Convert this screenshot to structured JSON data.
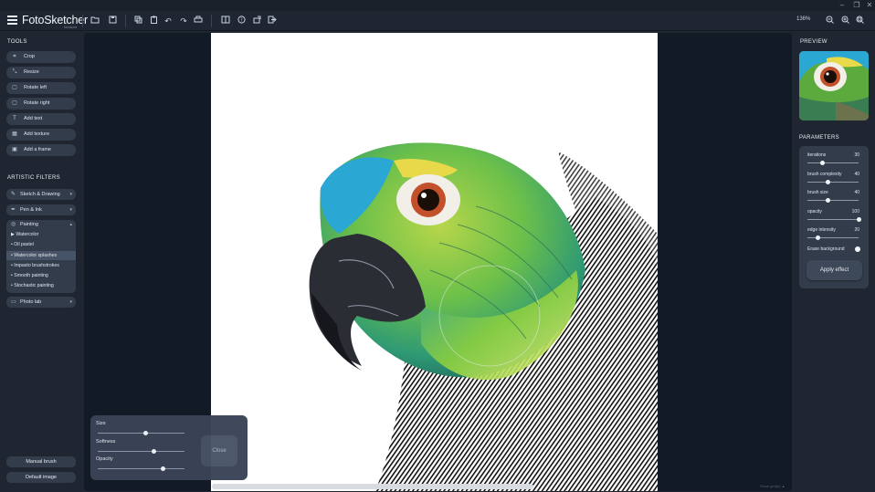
{
  "app": {
    "title": "FotoSketcher",
    "subtitle": "foto&art",
    "window_controls": [
      "–",
      "❐",
      "✕"
    ]
  },
  "toolbar": {
    "zoom": "136%",
    "icons": [
      "open-folder-icon",
      "save-icon",
      "copy-icon",
      "paste-icon",
      "undo-icon",
      "redo-icon",
      "print-icon",
      "compare-icon",
      "help-icon",
      "share-icon",
      "exit-icon",
      "zoom-out-icon",
      "zoom-in-icon",
      "zoom-fit-icon"
    ]
  },
  "tools": {
    "title": "TOOLS",
    "items": [
      {
        "label": "Crop",
        "icon": "crop-icon"
      },
      {
        "label": "Resize",
        "icon": "resize-icon"
      },
      {
        "label": "Rotate left",
        "icon": "rotate-left-icon"
      },
      {
        "label": "Rotate right",
        "icon": "rotate-right-icon"
      },
      {
        "label": "Add text",
        "icon": "text-icon"
      },
      {
        "label": "Add texture",
        "icon": "texture-icon"
      },
      {
        "label": "Add a frame",
        "icon": "frame-icon"
      }
    ]
  },
  "filters": {
    "title": "ARTISTIC FILTERS",
    "sketch": "Sketch & Drawing",
    "pen": "Pen & Ink",
    "painting": "Painting",
    "painting_items": [
      "▶ Watercolor",
      "• Oil pastel",
      "• Watercolor splashes",
      "• Impasto brushstrokes",
      "• Smooth painting",
      "• Stochastic painting"
    ],
    "selected_index": 2,
    "photo_lab": "Photo lab"
  },
  "bottom_buttons": {
    "manual_brush": "Manual brush",
    "default_image": "Default image"
  },
  "brush_popup": {
    "size_label": "Size",
    "softness_label": "Softness",
    "opacity_label": "Opacity",
    "size_value": 0.55,
    "softness_value": 0.65,
    "opacity_value": 0.75,
    "close_label": "Close"
  },
  "preview": {
    "title": "PREVIEW"
  },
  "parameters": {
    "title": "PARAMETERS",
    "items": [
      {
        "label": "iterations",
        "value": "30",
        "fraction": 0.3
      },
      {
        "label": "brush complexity",
        "value": "40",
        "fraction": 0.4
      },
      {
        "label": "brush size",
        "value": "40",
        "fraction": 0.4
      },
      {
        "label": "opacity",
        "value": "100",
        "fraction": 1.0
      },
      {
        "label": "edge intensity",
        "value": "20",
        "fraction": 0.2
      }
    ],
    "erase_background": "Erase background",
    "apply": "Apply effect"
  },
  "status": {
    "watermark": "Show grid(s)  ▲"
  }
}
